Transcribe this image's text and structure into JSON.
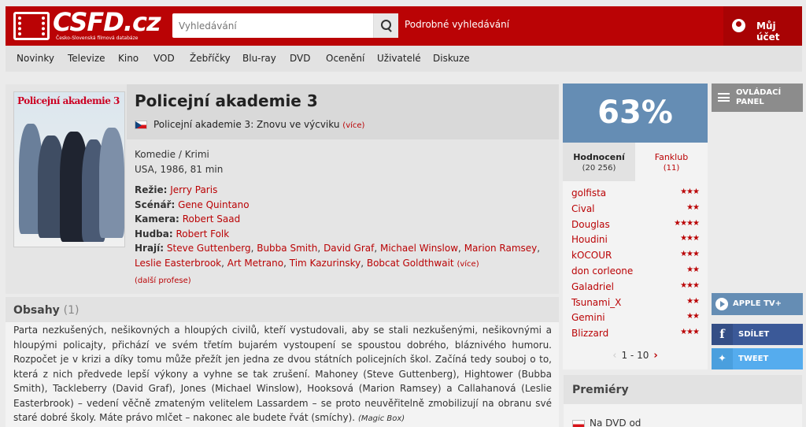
{
  "header": {
    "logo_word": "CSFD.cz",
    "logo_tagline": "Česko-Slovenská filmová databáze",
    "search_placeholder": "Vyhledávání",
    "advanced_search": "Podrobné vyhledávání",
    "account": "Můj účet"
  },
  "nav": [
    "Novinky",
    "Televize",
    "Kino",
    "VOD",
    "Žebříčky",
    "Blu-ray",
    "DVD",
    "Ocenění",
    "Uživatelé",
    "Diskuze"
  ],
  "film": {
    "poster_title": "Policejní akademie 3",
    "title": "Policejní akademie 3",
    "alt_title": "Policejní akademie 3: Znovu ve výcviku",
    "alt_more": "(více)",
    "genre": "Komedie / Krimi",
    "origin": "USA, 1986, 81 min",
    "directing_label": "Režie:",
    "director": "Jerry Paris",
    "screenplay_label": "Scénář:",
    "screenplay": "Gene Quintano",
    "camera_label": "Kamera:",
    "camera": "Robert Saad",
    "music_label": "Hudba:",
    "music": "Robert Folk",
    "cast_label": "Hrají:",
    "cast": [
      "Steve Guttenberg",
      "Bubba Smith",
      "David Graf",
      "Michael Winslow",
      "Marion Ramsey",
      "Leslie Easterbrook",
      "Art Metrano",
      "Tim Kazurinsky",
      "Bobcat Goldthwait"
    ],
    "cast_more": "(více)",
    "more_professions": "(další profese)"
  },
  "plot": {
    "title": "Obsahy",
    "count": "(1)",
    "text": "Parta nezkušených, nešikovných a hloupých civilů, kteří vystudovali, aby se stali nezkušenými, nešikovnými a hloupými policajty, přichází ve svém třetím bujarém vystoupení se spoustou dobrého, bláznivého humoru. Rozpočet je v krizi a díky tomu může přežít jen jedna ze dvou státních policejních škol. Začíná tedy souboj o to, která z nich předvede lepší výkony a vyhne se tak zrušení. Mahoney (Steve Guttenberg), Hightower (Bubba Smith), Tackleberry (David Graf), Jones (Michael Winslow), Hooksová (Marion Ramsey) a Callahanová (Leslie Easterbrook) – vedení věčně zmateným velitelem Lassardem – se proto neuvěřitelně zmobilizují na obranu své staré dobré školy. Máte právo mlčet – nakonec ale budete řvát (smíchy).",
    "source": "(Magic Box)"
  },
  "rating": {
    "value": "63%",
    "tab_ratings": "Hodnocení",
    "tab_ratings_count": "(20 256)",
    "tab_fanclub": "Fanklub",
    "tab_fanclub_count": "(11)",
    "users": [
      {
        "name": "golfista",
        "stars": "★★★"
      },
      {
        "name": "Cival",
        "stars": "★★"
      },
      {
        "name": "Douglas",
        "stars": "★★★★"
      },
      {
        "name": "Houdini",
        "stars": "★★★"
      },
      {
        "name": "kOCOUR",
        "stars": "★★★"
      },
      {
        "name": "don corleone",
        "stars": "★★"
      },
      {
        "name": "Galadriel",
        "stars": "★★★"
      },
      {
        "name": "Tsunami_X",
        "stars": "★★"
      },
      {
        "name": "Gemini",
        "stars": "★★"
      },
      {
        "name": "Blizzard",
        "stars": "★★★"
      }
    ],
    "pager": "1 - 10"
  },
  "sidebar": {
    "control_panel": "OVLÁDACÍ PANEL",
    "apple_tv": "APPLE TV+",
    "share": "SDÍLET",
    "tweet": "TWEET"
  },
  "premiery": {
    "title": "Premiéry",
    "dvd": "Na DVD od"
  },
  "colors": {
    "brand_red": "#ba0305",
    "rating_blue": "#658db4",
    "facebook": "#3b5998",
    "twitter": "#55acee"
  }
}
